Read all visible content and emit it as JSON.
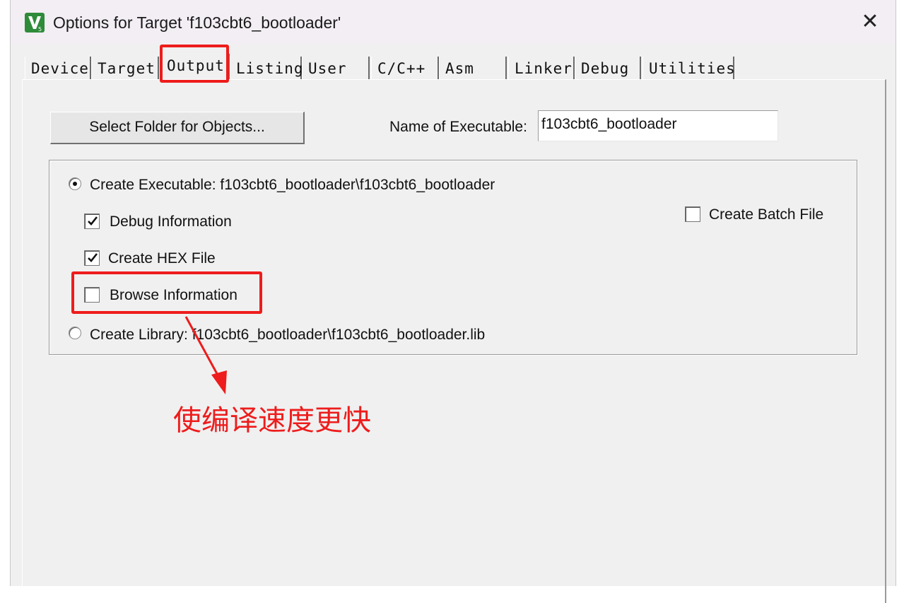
{
  "window": {
    "title": "Options for Target 'f103cbt6_bootloader'",
    "close_glyph": "✕"
  },
  "tabs": [
    {
      "label": "Device"
    },
    {
      "label": "Target"
    },
    {
      "label": "Output",
      "active": true
    },
    {
      "label": "Listing"
    },
    {
      "label": "User"
    },
    {
      "label": "C/C++"
    },
    {
      "label": "Asm"
    },
    {
      "label": "Linker"
    },
    {
      "label": "Debug"
    },
    {
      "label": "Utilities"
    }
  ],
  "output": {
    "select_folder_label": "Select Folder for Objects...",
    "name_of_executable_label": "Name of Executable:",
    "name_of_executable_value": "f103cbt6_bootloader",
    "create_executable_label": "Create Executable:  f103cbt6_bootloader\\f103cbt6_bootloader",
    "create_executable_selected": true,
    "debug_information_label": "Debug Information",
    "debug_information_checked": true,
    "create_hex_label": "Create HEX File",
    "create_hex_checked": true,
    "browse_information_label": "Browse Information",
    "browse_information_checked": false,
    "create_library_label": "Create Library:  f103cbt6_bootloader\\f103cbt6_bootloader.lib",
    "create_library_selected": false,
    "create_batch_label": "Create Batch File",
    "create_batch_checked": false
  },
  "annotation": {
    "text": "使编译速度更快",
    "color": "#ee1c1c"
  },
  "icons": {
    "app": "keil-uvision-icon",
    "close": "close-icon",
    "check": "checkmark-icon"
  }
}
